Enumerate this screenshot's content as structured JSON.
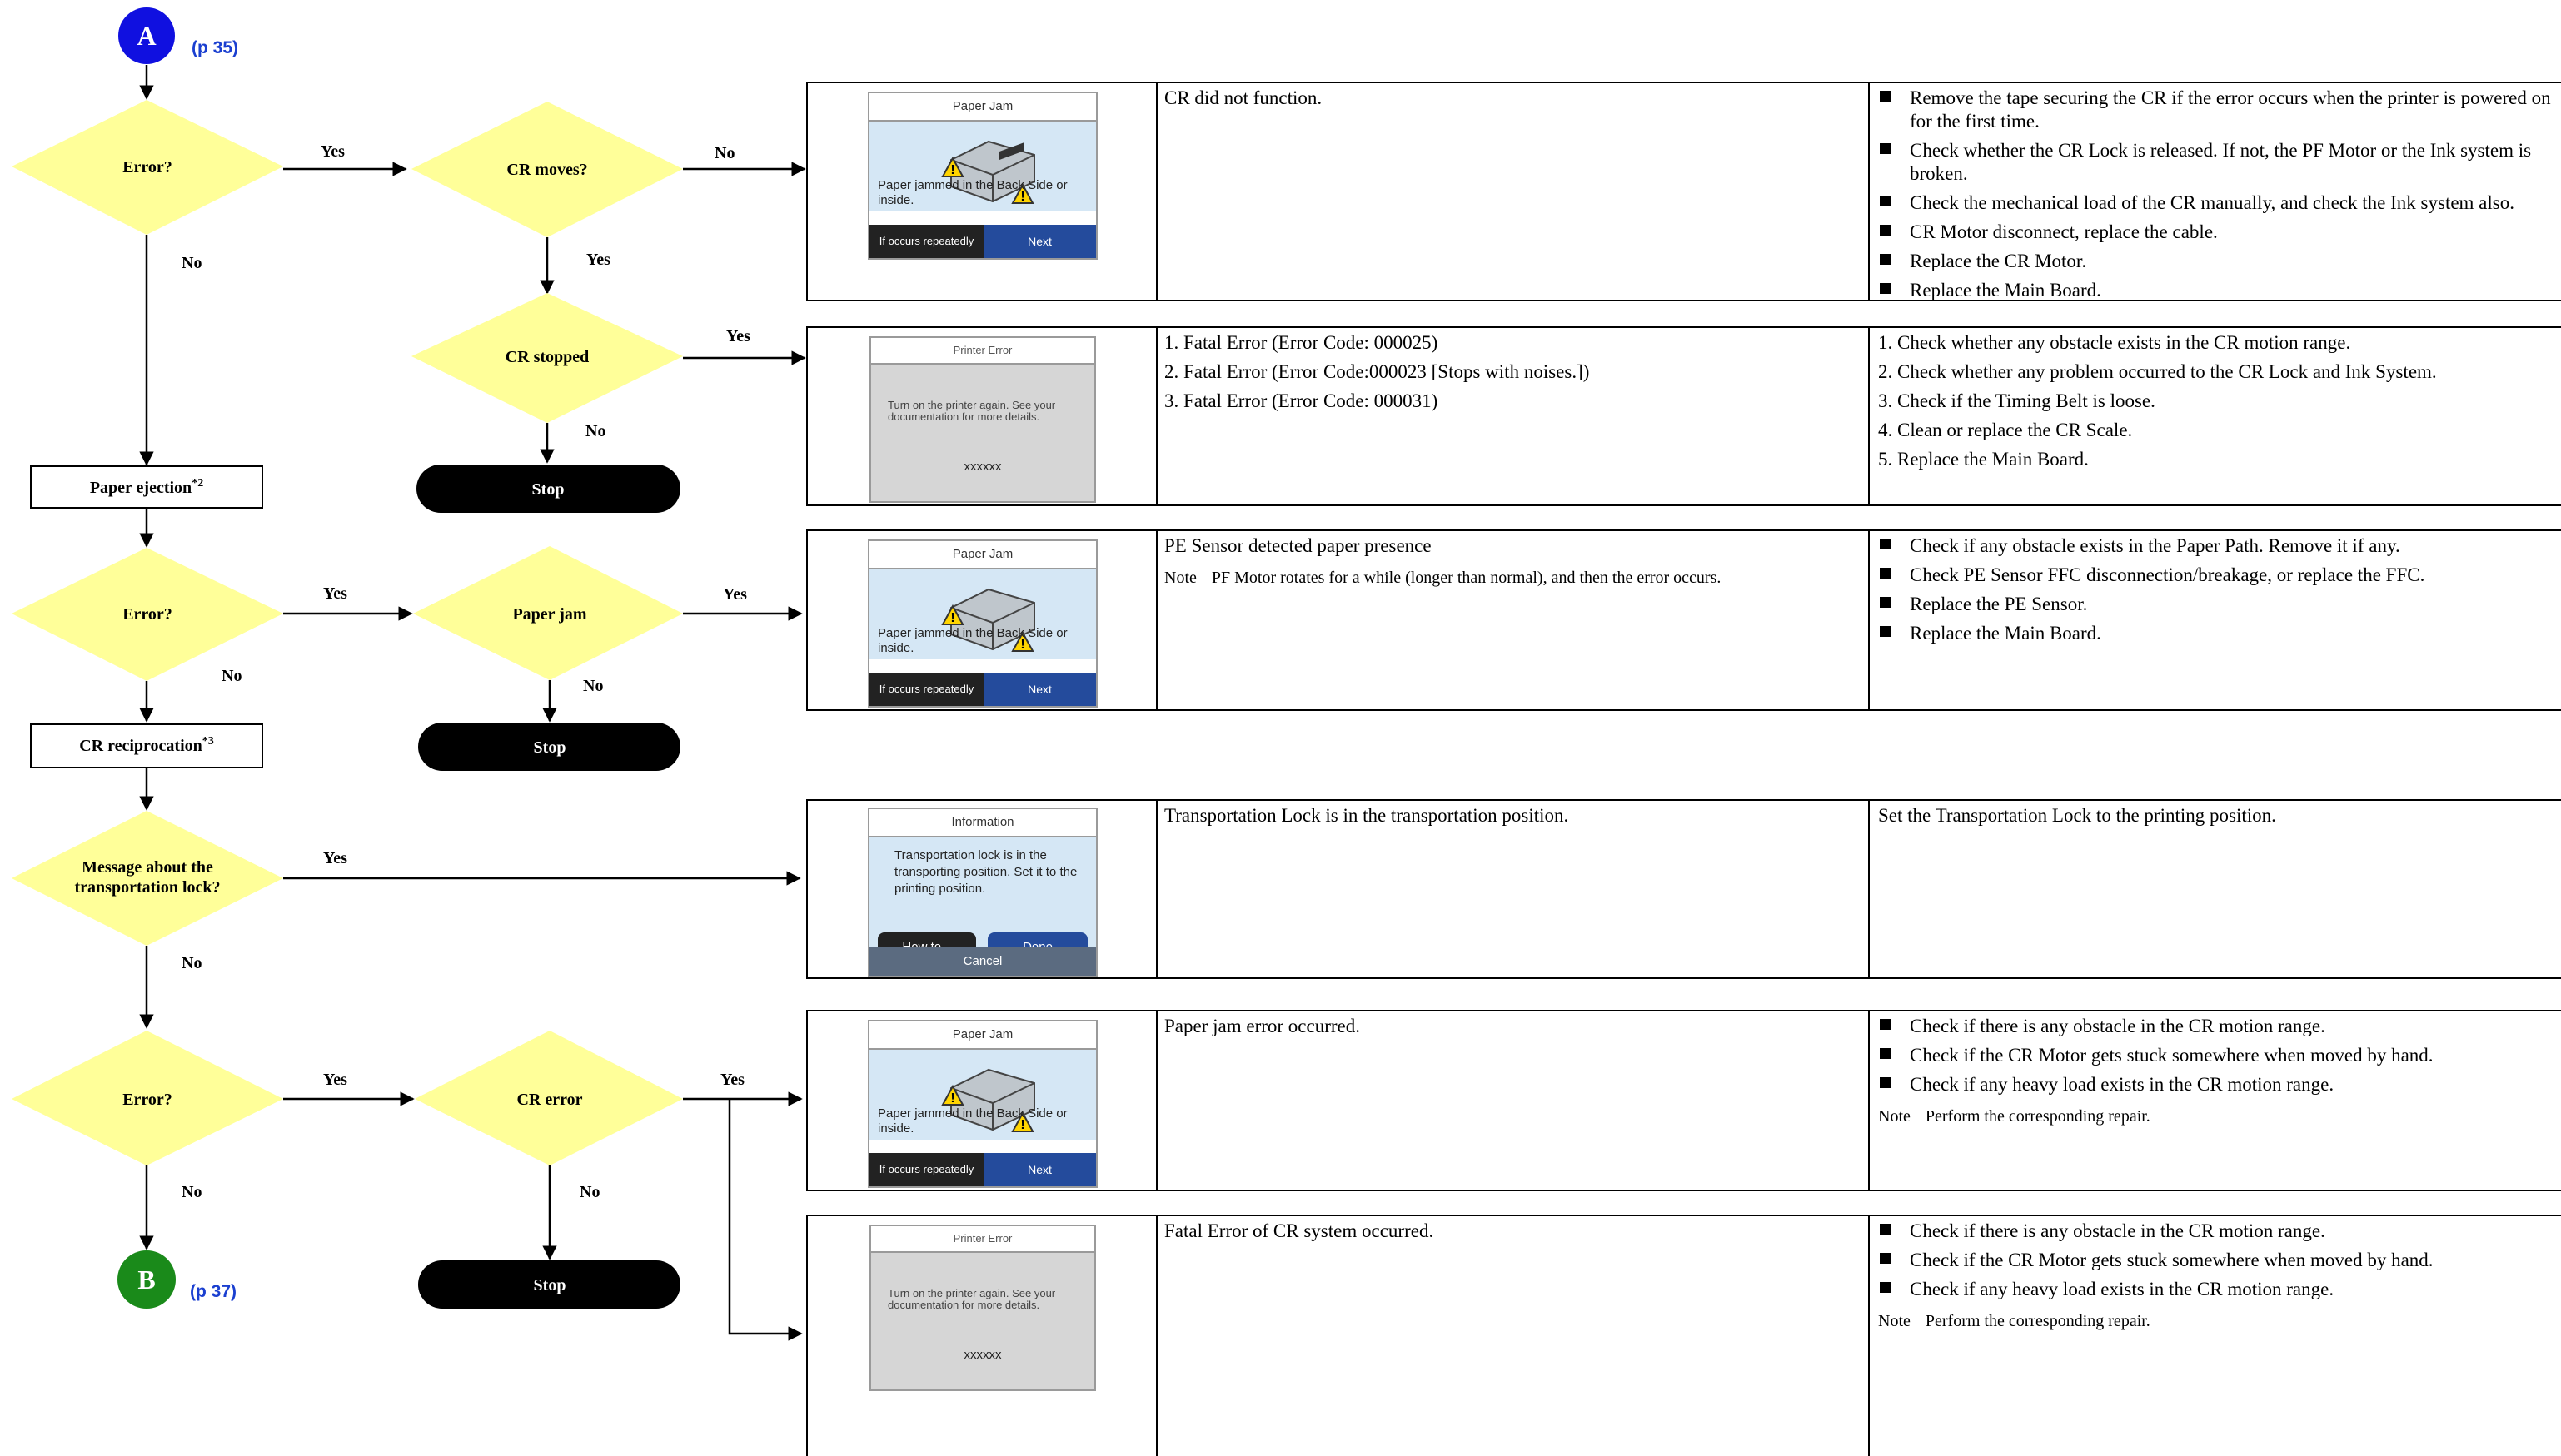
{
  "colors": {
    "decision_fill": "#ffff99",
    "terminal_fill": "#000000",
    "start_circle": "#1010e0",
    "end_circle": "#1a8a1a",
    "page_ref": "#1a3fd0"
  },
  "connectors": {
    "start": "A",
    "start_ref": "(p 35)",
    "end": "B",
    "end_ref": "(p 37)"
  },
  "nodes": {
    "error1": "Error?",
    "cr_moves": "CR moves?",
    "cr_stopped": "CR stopped",
    "stop1": "Stop",
    "paper_ejection": "Paper ejection",
    "paper_ejection_sup": "*2",
    "error2": "Error?",
    "paper_jam": "Paper jam",
    "stop2": "Stop",
    "cr_reciprocation": "CR reciprocation",
    "cr_reciprocation_sup": "*3",
    "transport_msg_1": "Message about the",
    "transport_msg_2": "transportation lock?",
    "error3": "Error?",
    "cr_error": "CR error",
    "stop3": "Stop"
  },
  "edge_labels": {
    "yes": "Yes",
    "no": "No"
  },
  "screens": {
    "paper_jam_title": "Paper Jam",
    "paper_jam_msg": "Paper jammed in the Back Side or inside.",
    "paper_jam_repeat": "If occurs repeatedly",
    "paper_jam_next": "Next",
    "printer_error_title": "Printer Error",
    "printer_error_msg": "Turn on the printer again. See your documentation for more details.",
    "printer_error_code": "xxxxxx",
    "info_title": "Information",
    "info_msg": "Transportation lock is in the transporting position. Set it to the printing position.",
    "info_howto": "How to...",
    "info_done": "Done",
    "info_cancel": "Cancel"
  },
  "rows": [
    {
      "phenomenon": "CR did not function.",
      "remedies": [
        "Remove the tape securing the CR if the error occurs when the printer is powered on for the first time.",
        "Check whether the CR Lock is released. If not, the PF Motor or the Ink system is broken.",
        "Check the mechanical load of the CR manually, and check the Ink system also.",
        "CR Motor disconnect, replace the cable.",
        "Replace the CR Motor.",
        "Replace the Main Board."
      ]
    },
    {
      "phenomenon_list": [
        "1.  Fatal Error (Error Code: 000025)",
        "2.  Fatal Error (Error Code:000023 [Stops with noises.])",
        "3.  Fatal Error (Error Code: 000031)"
      ],
      "remedies_numbered": [
        "1.  Check whether any obstacle exists in the CR motion range.",
        "2.  Check whether any problem occurred to the CR Lock and Ink System.",
        "3.  Check if the Timing Belt is loose.",
        "4.  Clean or replace the CR Scale.",
        "5.  Replace the Main Board."
      ]
    },
    {
      "phenomenon": "PE Sensor detected paper presence",
      "note_label": "Note",
      "note": "PF Motor rotates for a while (longer than normal), and then the error occurs.",
      "remedies": [
        "Check if any obstacle exists in the Paper Path. Remove it if any.",
        "Check PE Sensor FFC disconnection/breakage, or replace the FFC.",
        "Replace the PE Sensor.",
        "Replace the Main Board."
      ]
    },
    {
      "phenomenon": "Transportation Lock is in the transportation position.",
      "remedy_text": "Set the Transportation Lock to the printing position."
    },
    {
      "phenomenon": "Paper jam error occurred.",
      "remedies": [
        "Check if there is any obstacle in the CR motion range.",
        "Check if the CR Motor gets stuck somewhere when moved by hand.",
        "Check if any heavy load exists in the CR motion range."
      ],
      "note_label": "Note",
      "note": "Perform the corresponding repair."
    },
    {
      "phenomenon": "Fatal Error of CR system occurred.",
      "remedies": [
        "Check if there is any obstacle in the CR motion range.",
        "Check if the CR Motor gets stuck somewhere when moved by hand.",
        "Check if any heavy load exists in the CR motion range."
      ],
      "note_label": "Note",
      "note": "Perform the corresponding repair."
    }
  ]
}
